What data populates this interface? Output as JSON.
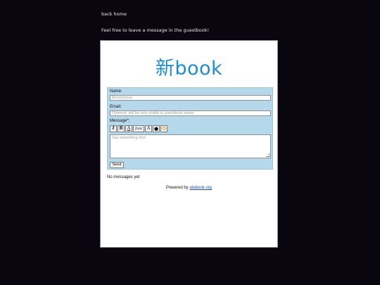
{
  "nav": {
    "back_label": "back home"
  },
  "intro": {
    "text": "Feel free to leave a message in the guestbook!"
  },
  "guestbook": {
    "logo": "新book",
    "name_label": "Name:",
    "name_placeholder": "Anonymous",
    "email_label": "Email:",
    "email_placeholder": "Optional, will be only visible to guestbook owner",
    "message_label": "Message*:",
    "message_placeholder": "Say something nice",
    "toolbar": {
      "italic": "I",
      "bold": "B",
      "underline": "A",
      "font": "font",
      "text_size": "A",
      "color": "●",
      "emoji": "☺"
    },
    "send_label": "Send",
    "empty_text": "No messages yet",
    "powered_prefix": "Powered by ",
    "powered_link": "atabook.org"
  },
  "colors": {
    "page_background": "#0a0610",
    "logo": "#1f8dc9",
    "form_background": "#b5d8ea",
    "link": "#1a4fb0"
  }
}
